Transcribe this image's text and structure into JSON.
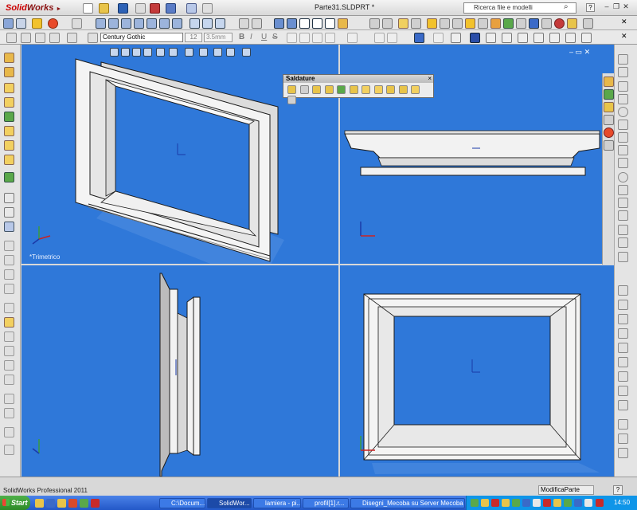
{
  "app": {
    "logo_part1": "Solid",
    "logo_part2": "Works",
    "document_title": "Parte31.SLDPRT *",
    "search_placeholder": "Ricerca file e modelli",
    "help_label": "?"
  },
  "format_toolbar": {
    "font": "Century Gothic",
    "size": "12",
    "height": "3.5mm",
    "bold": "B",
    "italic": "I",
    "underline": "U",
    "strike": "S"
  },
  "weldments_toolbar": {
    "title": "Saldature",
    "close": "×"
  },
  "viewports": {
    "top_left_label": "*Trimetrico"
  },
  "status_bar": {
    "product": "SolidWorks Professional 2011",
    "mode": "ModificaParte",
    "help": "?"
  },
  "taskbar": {
    "start_label": "Start",
    "tasks": [
      {
        "label": "C:\\Docum...",
        "active": false
      },
      {
        "label": "SolidWor...",
        "active": true
      },
      {
        "label": "lamiera - pi...",
        "active": false
      },
      {
        "label": "profil[1].r...",
        "active": false
      },
      {
        "label": "Disegni_Mecoba su Server Mecoba (Server",
        "active": false
      }
    ],
    "clock": "14:50"
  },
  "colors": {
    "viewport_bg": "#2f78d9",
    "model_face": "#f2f2f2",
    "model_edge": "#1a1a1a",
    "taskbar": "#2358c8",
    "start_button": "#3a9a34"
  },
  "icons": {
    "axis_triad": "xyz-triad-icon",
    "origin": "origin-marker-icon",
    "search": "search-icon",
    "close": "close-icon"
  }
}
